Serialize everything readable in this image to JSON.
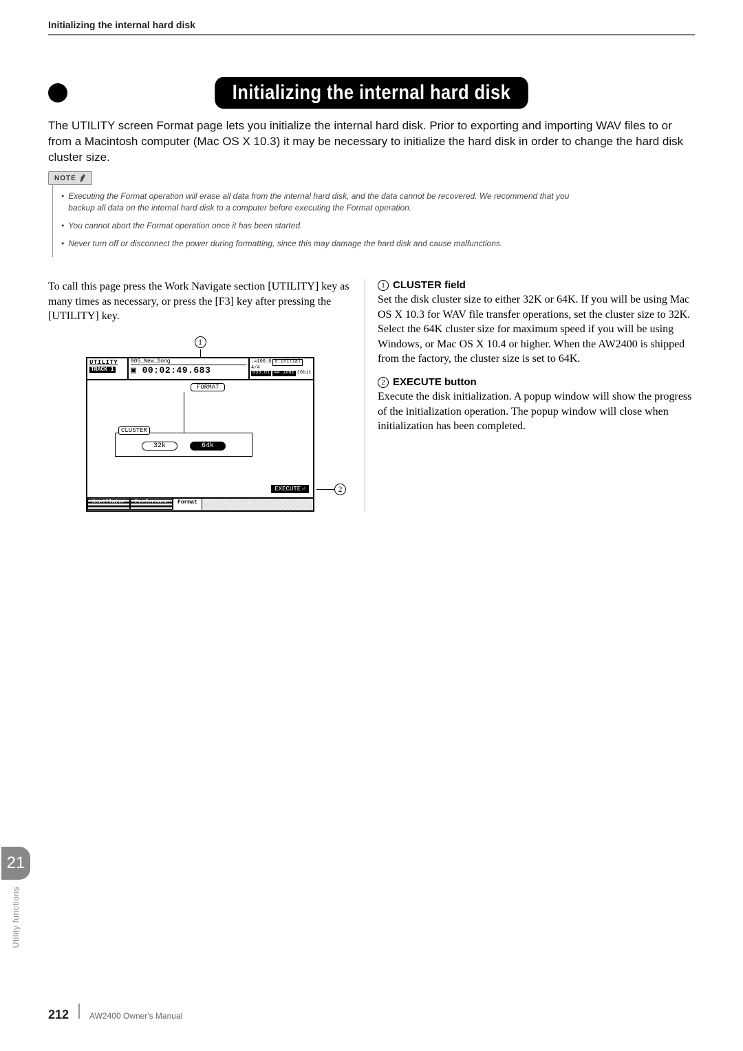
{
  "header": {
    "breadcrumb": "Initializing the internal hard disk"
  },
  "title": "Initializing the internal hard disk",
  "intro": "The UTILITY screen Format page lets you initialize the internal hard disk. Prior to exporting and importing WAV files to or from a Macintosh computer (Mac OS X 10.3) it may be necessary to initialize the hard disk in order to change the hard disk cluster size.",
  "note": {
    "tag": "NOTE",
    "items": [
      "Executing the Format operation will erase all data from the internal hard disk, and the data cannot be recovered. We recommend that you backup all data on the internal hard disk to a computer before executing the Format operation.",
      "You cannot abort the Format operation once it has been started.",
      "Never turn off or disconnect the power during formatting, since this may damage the hard disk and cause malfunctions."
    ]
  },
  "left": {
    "paragraph": "To call this page press the Work Navigate section [UTILITY] key as many times as necessary, or press the [F3] key after pressing the [UTILITY] key.",
    "callouts": {
      "one": "1",
      "two": "2"
    },
    "screen": {
      "utility_label": "UTILITY",
      "track_label": "TRACK 1",
      "song_line": "005_New_Song",
      "time_line": "▣ 00:02:49.683",
      "tempo": "♩=100.0",
      "sig": "4/4",
      "initial": "0.Initial",
      "meas": "059.01",
      "rate": "44.1kHz",
      "bits": "16bit",
      "format_btn": "FORMAT",
      "cluster_label": "CLUSTER",
      "opt32": "32k",
      "opt64": "64k",
      "execute_btn": "EXECUTE",
      "tabs": {
        "osc": "Oscillator",
        "pref": "Preference",
        "format": "Format"
      }
    }
  },
  "right": {
    "cluster": {
      "num": "1",
      "title": "CLUSTER field",
      "para": "Set the disk cluster size to either 32K or 64K.\nIf you will be using Mac OS X 10.3 for WAV file transfer operations, set the cluster size to 32K. Select the 64K cluster size for maximum speed if you will be using Windows, or Mac OS X 10.4 or higher. When the AW2400 is shipped from the factory, the cluster size is set to 64K."
    },
    "execute": {
      "num": "2",
      "title": "EXECUTE button",
      "para": "Execute the disk initialization. A popup window will show the progress of the initialization operation.\nThe popup window will close when initialization has been completed."
    }
  },
  "side": {
    "chapter": "21",
    "label": "Utility functions"
  },
  "footer": {
    "page": "212",
    "manual": "AW2400  Owner's Manual"
  }
}
